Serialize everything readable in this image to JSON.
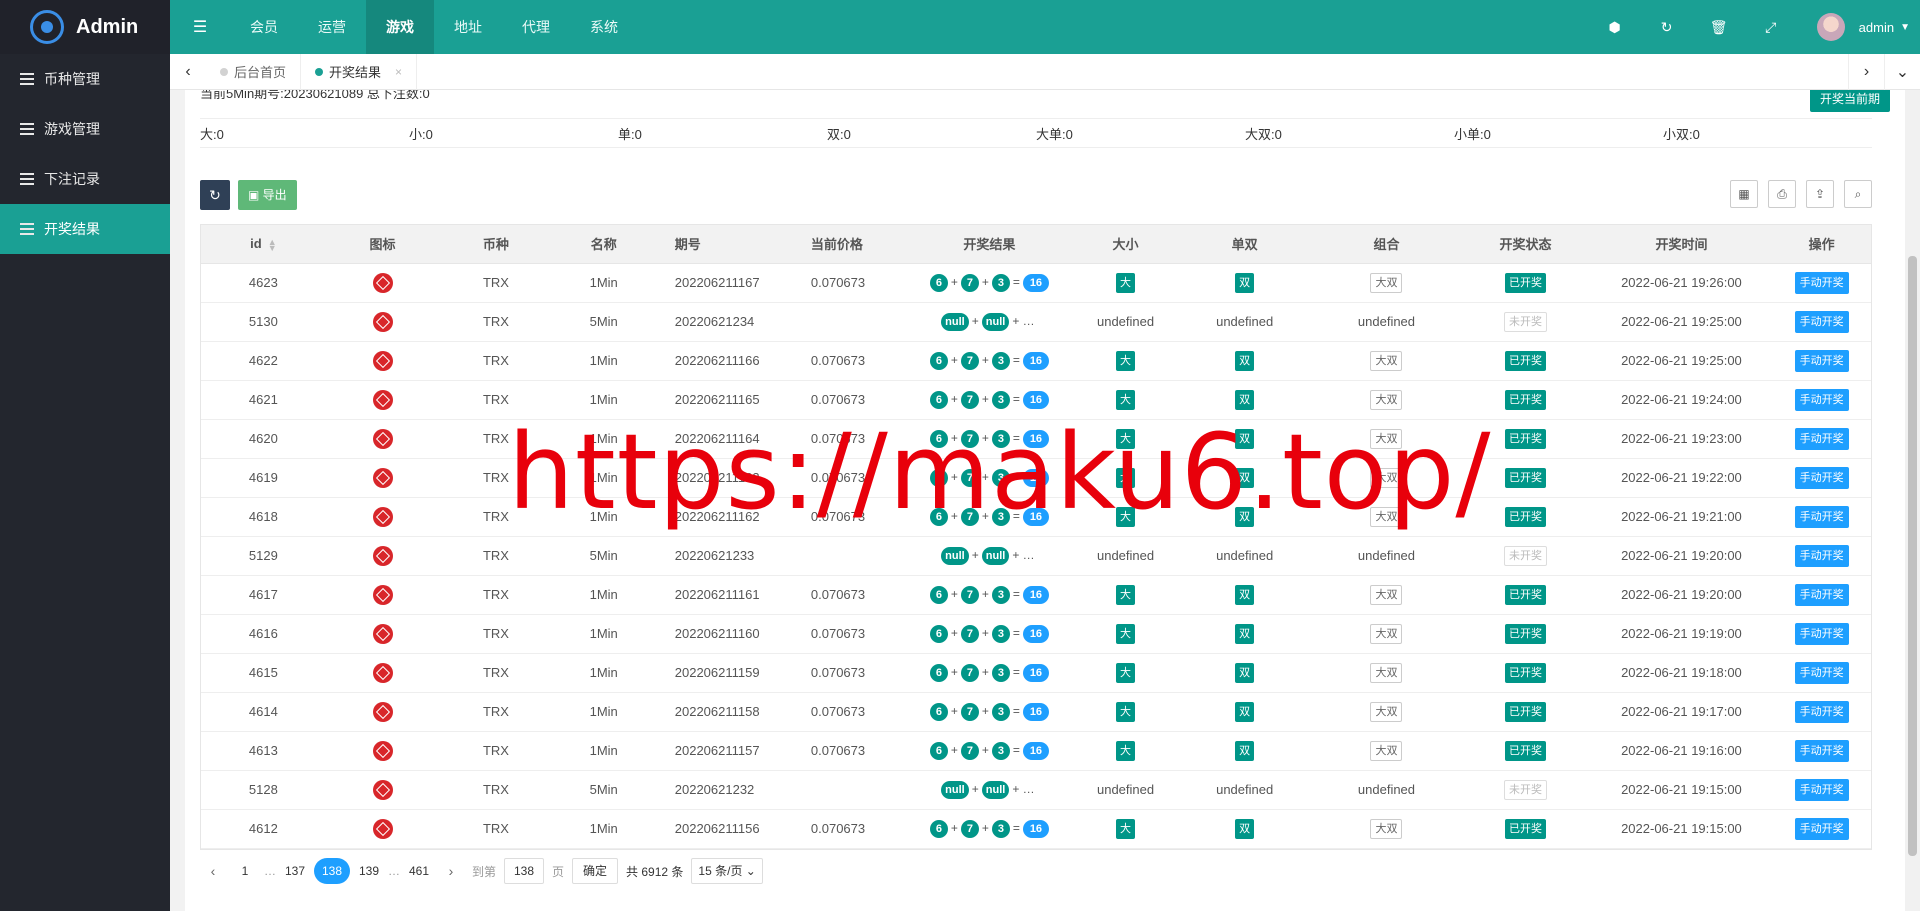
{
  "app": {
    "title": "Admin"
  },
  "sidebar": {
    "items": [
      {
        "label": "币种管理",
        "active": false
      },
      {
        "label": "游戏管理",
        "active": false
      },
      {
        "label": "下注记录",
        "active": false
      },
      {
        "label": "开奖结果",
        "active": true
      }
    ]
  },
  "topnav": {
    "items": [
      {
        "label": "会员",
        "active": false
      },
      {
        "label": "运营",
        "active": false
      },
      {
        "label": "游戏",
        "active": true
      },
      {
        "label": "地址",
        "active": false
      },
      {
        "label": "代理",
        "active": false
      },
      {
        "label": "系统",
        "active": false
      }
    ],
    "username": "admin"
  },
  "tabs": [
    {
      "label": "后台首页",
      "active": false
    },
    {
      "label": "开奖结果",
      "active": true
    }
  ],
  "current_line": "当前5Min期号:20230621089 总下注数:0",
  "open_button": "开奖当前期",
  "stats": [
    "大:0",
    "小:0",
    "单:0",
    "双:0",
    "大单:0",
    "大双:0",
    "小单:0",
    "小双:0"
  ],
  "toolbar": {
    "export_label": "导出"
  },
  "table": {
    "headers": [
      "id",
      "图标",
      "币种",
      "名称",
      "期号",
      "当前价格",
      "开奖结果",
      "大小",
      "单双",
      "组合",
      "开奖状态",
      "开奖时间",
      "操作"
    ],
    "rows": [
      {
        "id": "4623",
        "coin": "TRX",
        "name": "1Min",
        "period": "202206211167",
        "price": "0.070673",
        "result": [
          "6",
          "7",
          "3",
          "16"
        ],
        "size": "大",
        "parity": "双",
        "combo": "大双",
        "status": "已开奖",
        "time": "2022-06-21 19:26:00",
        "action": "手动开奖"
      },
      {
        "id": "5130",
        "coin": "TRX",
        "name": "5Min",
        "period": "20220621234",
        "price": "",
        "result": [
          "null",
          "null"
        ],
        "size": "undefined",
        "parity": "undefined",
        "combo": "undefined",
        "status": "未开奖",
        "time": "2022-06-21 19:25:00",
        "action": "手动开奖"
      },
      {
        "id": "4622",
        "coin": "TRX",
        "name": "1Min",
        "period": "202206211166",
        "price": "0.070673",
        "result": [
          "6",
          "7",
          "3",
          "16"
        ],
        "size": "大",
        "parity": "双",
        "combo": "大双",
        "status": "已开奖",
        "time": "2022-06-21 19:25:00",
        "action": "手动开奖"
      },
      {
        "id": "4621",
        "coin": "TRX",
        "name": "1Min",
        "period": "202206211165",
        "price": "0.070673",
        "result": [
          "6",
          "7",
          "3",
          "16"
        ],
        "size": "大",
        "parity": "双",
        "combo": "大双",
        "status": "已开奖",
        "time": "2022-06-21 19:24:00",
        "action": "手动开奖"
      },
      {
        "id": "4620",
        "coin": "TRX",
        "name": "1Min",
        "period": "202206211164",
        "price": "0.070673",
        "result": [
          "6",
          "7",
          "3",
          "16"
        ],
        "size": "大",
        "parity": "双",
        "combo": "大双",
        "status": "已开奖",
        "time": "2022-06-21 19:23:00",
        "action": "手动开奖"
      },
      {
        "id": "4619",
        "coin": "TRX",
        "name": "1Min",
        "period": "202206211163",
        "price": "0.070673",
        "result": [
          "6",
          "7",
          "3",
          "16"
        ],
        "size": "大",
        "parity": "双",
        "combo": "大双",
        "status": "已开奖",
        "time": "2022-06-21 19:22:00",
        "action": "手动开奖"
      },
      {
        "id": "4618",
        "coin": "TRX",
        "name": "1Min",
        "period": "202206211162",
        "price": "0.070673",
        "result": [
          "6",
          "7",
          "3",
          "16"
        ],
        "size": "大",
        "parity": "双",
        "combo": "大双",
        "status": "已开奖",
        "time": "2022-06-21 19:21:00",
        "action": "手动开奖"
      },
      {
        "id": "5129",
        "coin": "TRX",
        "name": "5Min",
        "period": "20220621233",
        "price": "",
        "result": [
          "null",
          "null"
        ],
        "size": "undefined",
        "parity": "undefined",
        "combo": "undefined",
        "status": "未开奖",
        "time": "2022-06-21 19:20:00",
        "action": "手动开奖"
      },
      {
        "id": "4617",
        "coin": "TRX",
        "name": "1Min",
        "period": "202206211161",
        "price": "0.070673",
        "result": [
          "6",
          "7",
          "3",
          "16"
        ],
        "size": "大",
        "parity": "双",
        "combo": "大双",
        "status": "已开奖",
        "time": "2022-06-21 19:20:00",
        "action": "手动开奖"
      },
      {
        "id": "4616",
        "coin": "TRX",
        "name": "1Min",
        "period": "202206211160",
        "price": "0.070673",
        "result": [
          "6",
          "7",
          "3",
          "16"
        ],
        "size": "大",
        "parity": "双",
        "combo": "大双",
        "status": "已开奖",
        "time": "2022-06-21 19:19:00",
        "action": "手动开奖"
      },
      {
        "id": "4615",
        "coin": "TRX",
        "name": "1Min",
        "period": "202206211159",
        "price": "0.070673",
        "result": [
          "6",
          "7",
          "3",
          "16"
        ],
        "size": "大",
        "parity": "双",
        "combo": "大双",
        "status": "已开奖",
        "time": "2022-06-21 19:18:00",
        "action": "手动开奖"
      },
      {
        "id": "4614",
        "coin": "TRX",
        "name": "1Min",
        "period": "202206211158",
        "price": "0.070673",
        "result": [
          "6",
          "7",
          "3",
          "16"
        ],
        "size": "大",
        "parity": "双",
        "combo": "大双",
        "status": "已开奖",
        "time": "2022-06-21 19:17:00",
        "action": "手动开奖"
      },
      {
        "id": "4613",
        "coin": "TRX",
        "name": "1Min",
        "period": "202206211157",
        "price": "0.070673",
        "result": [
          "6",
          "7",
          "3",
          "16"
        ],
        "size": "大",
        "parity": "双",
        "combo": "大双",
        "status": "已开奖",
        "time": "2022-06-21 19:16:00",
        "action": "手动开奖"
      },
      {
        "id": "5128",
        "coin": "TRX",
        "name": "5Min",
        "period": "20220621232",
        "price": "",
        "result": [
          "null",
          "null"
        ],
        "size": "undefined",
        "parity": "undefined",
        "combo": "undefined",
        "status": "未开奖",
        "time": "2022-06-21 19:15:00",
        "action": "手动开奖"
      },
      {
        "id": "4612",
        "coin": "TRX",
        "name": "1Min",
        "period": "202206211156",
        "price": "0.070673",
        "result": [
          "6",
          "7",
          "3",
          "16"
        ],
        "size": "大",
        "parity": "双",
        "combo": "大双",
        "status": "已开奖",
        "time": "2022-06-21 19:15:00",
        "action": "手动开奖"
      }
    ]
  },
  "pagination": {
    "first": "1",
    "prev_page": "137",
    "current": "138",
    "next_page": "139",
    "last": "461",
    "dots": "…",
    "goto_label": "到第",
    "goto_value": "138",
    "page_unit": "页",
    "confirm": "确定",
    "total": "共 6912 条",
    "page_size": "15 条/页"
  },
  "watermark": "https://maku6.top/",
  "colors": {
    "primary": "#1aa094",
    "sidebar": "#23262e",
    "accent_blue": "#1e9fff",
    "danger": "#d8262a"
  }
}
